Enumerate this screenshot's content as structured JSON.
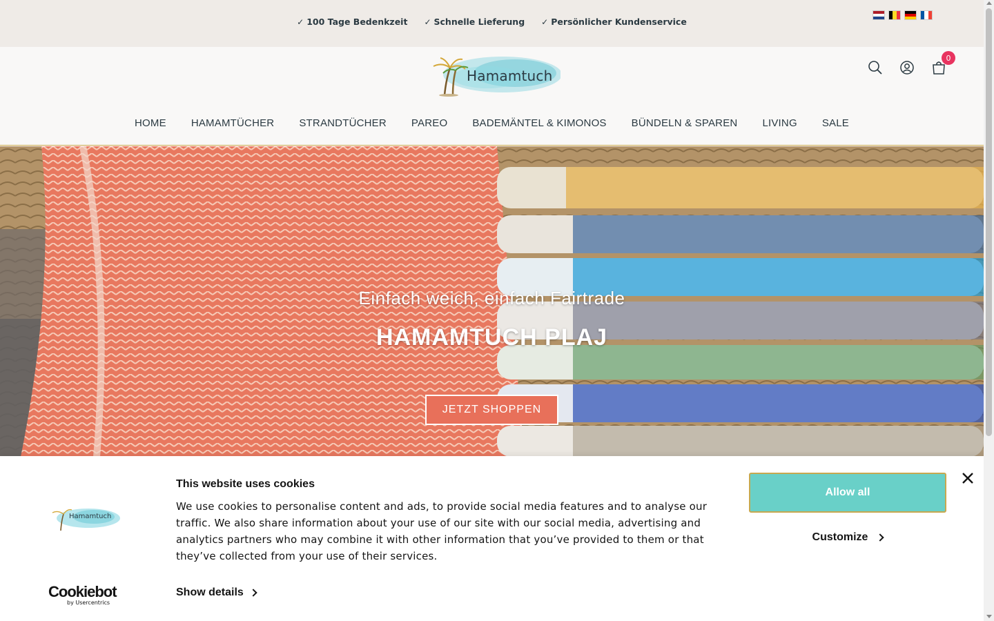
{
  "usp_bar": {
    "items": [
      {
        "check": "✓",
        "label": "100 Tage Bedenkzeit"
      },
      {
        "check": "✓",
        "label": "Schnelle Lieferung"
      },
      {
        "check": "✓",
        "label": "Persönlicher Kundenservice"
      }
    ],
    "flags": [
      "netherlands-flag",
      "belgium-flag",
      "germany-flag",
      "france-flag"
    ]
  },
  "header": {
    "logo_text": "Hamamtuch",
    "icons": [
      "search-icon",
      "user-icon",
      "cart-icon"
    ],
    "cart_count": "0"
  },
  "nav": {
    "items": [
      "HOME",
      "HAMAMTÜCHER",
      "STRANDTÜCHER",
      "PAREO",
      "BADEMÄNTEL & KIMONOS",
      "BÜNDELN & SPAREN",
      "LIVING",
      "SALE"
    ]
  },
  "hero": {
    "subtitle": "Einfach weich, einfach Fairtrade",
    "title": "HAMAMTUCH PLAJ",
    "cta": "JETZT SHOPPEN"
  },
  "cookie_banner": {
    "title": "This website uses cookies",
    "text": "We use cookies to personalise content and ads, to provide social media features and to analyse our traffic. We also share information about your use of our site with our social media, advertising and analytics partners who may combine it with other information that you’ve provided to them or that they’ve collected from your use of their services.",
    "show_details": "Show details",
    "allow_all": "Allow all",
    "customize": "Customize",
    "brand_name": "Cookiebot",
    "brand_sub": "by Usercentrics",
    "logo_text": "Hamamtuch"
  },
  "colors": {
    "usp_bg": "#efebe7",
    "header_bg": "#f9f8f7",
    "accent_teal": "#69d0c8",
    "cta_coral": "#e8705a",
    "badge_pink": "#e8345f",
    "text_dark": "#2b3a42"
  }
}
